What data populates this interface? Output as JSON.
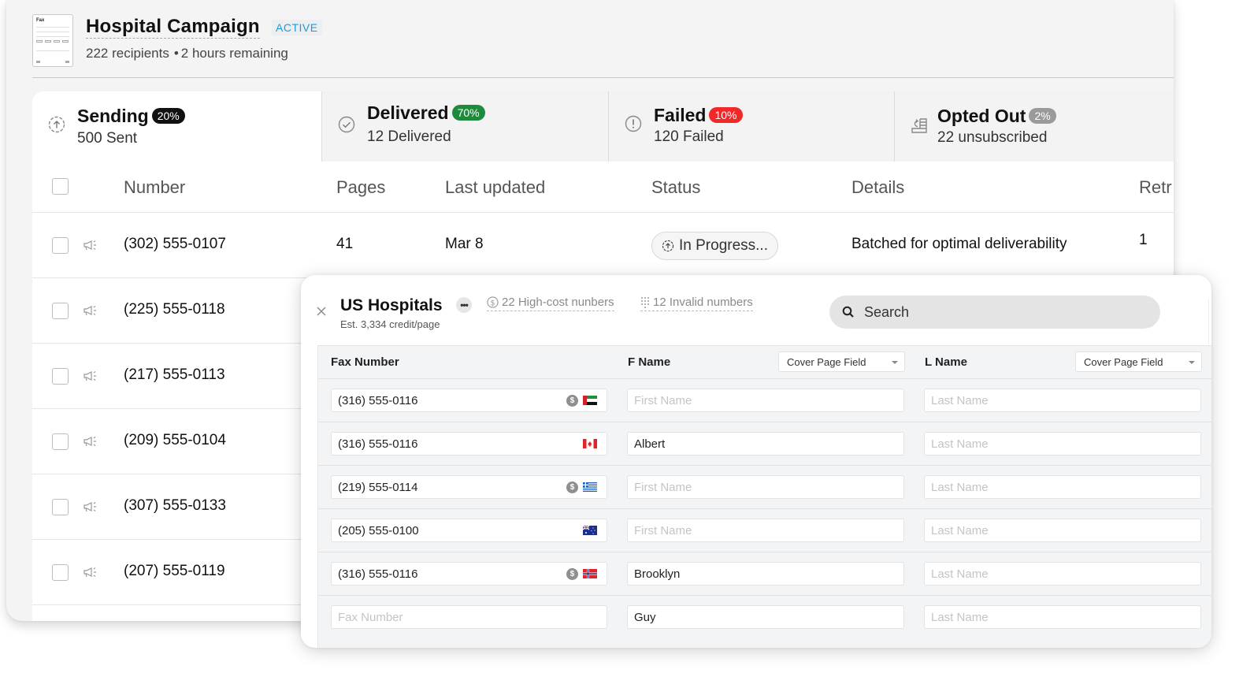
{
  "campaign": {
    "title": "Hospital Campaign",
    "status_badge": "ACTIVE",
    "recipients": "222 recipients",
    "separator": "•",
    "time_remaining": "2 hours remaining",
    "thumbnail_label": "Fax"
  },
  "stats": [
    {
      "label": "Sending",
      "badge": "20%",
      "badge_color": "#111111",
      "sub": "500 Sent",
      "icon": "upload-circle-icon"
    },
    {
      "label": "Delivered",
      "badge": "70%",
      "badge_color": "#1e8a3c",
      "sub": "12 Delivered",
      "icon": "check-circle-icon"
    },
    {
      "label": "Failed",
      "badge": "10%",
      "badge_color": "#f22727",
      "sub": "120 Failed",
      "icon": "alert-circle-icon"
    },
    {
      "label": "Opted Out",
      "badge": "2%",
      "badge_color": "#9a9a9a",
      "sub": "22 unsubscribed",
      "icon": "opt-out-icon"
    }
  ],
  "table": {
    "columns": [
      "Number",
      "Pages",
      "Last updated",
      "Status",
      "Details",
      "Retr"
    ],
    "rows": [
      {
        "number": "(302) 555-0107",
        "pages": "41",
        "updated": "Mar 8",
        "status": "In Progress...",
        "details": "Batched for optimal deliverability",
        "retries": "1"
      },
      {
        "number": "(225) 555-0118"
      },
      {
        "number": "(217) 555-0113"
      },
      {
        "number": "(209) 555-0104"
      },
      {
        "number": "(307) 555-0133"
      },
      {
        "number": "(207) 555-0119"
      }
    ]
  },
  "popup": {
    "title": "US Hospitals",
    "more_label": "•••",
    "subtitle": "Est. 3,334 credit/page",
    "high_cost": "22 High-cost nunbers",
    "invalid": "12 Invalid numbers",
    "search_placeholder": "Search",
    "columns": {
      "fax": "Fax Number",
      "fname": "F Name",
      "lname": "L Name",
      "fname_select": "Cover Page Field",
      "lname_select": "Cover Page Field"
    },
    "placeholders": {
      "fax": "Fax Number",
      "fname": "First Name",
      "lname": "Last Name"
    },
    "rows": [
      {
        "fax": "(316) 555-0116",
        "fname": "",
        "lname": "",
        "high_cost": true,
        "flag": "uae"
      },
      {
        "fax": "(316) 555-0116",
        "fname": "Albert",
        "lname": "",
        "high_cost": false,
        "flag": "canada"
      },
      {
        "fax": "(219) 555-0114",
        "fname": "",
        "lname": "",
        "high_cost": true,
        "flag": "greece"
      },
      {
        "fax": "(205) 555-0100",
        "fname": "",
        "lname": "",
        "high_cost": false,
        "flag": "australia"
      },
      {
        "fax": "(316) 555-0116",
        "fname": "Brooklyn",
        "lname": "",
        "high_cost": true,
        "flag": "norway"
      },
      {
        "fax": "",
        "fname": "Guy",
        "lname": "",
        "high_cost": false,
        "flag": ""
      }
    ],
    "cost_symbol": "$"
  }
}
